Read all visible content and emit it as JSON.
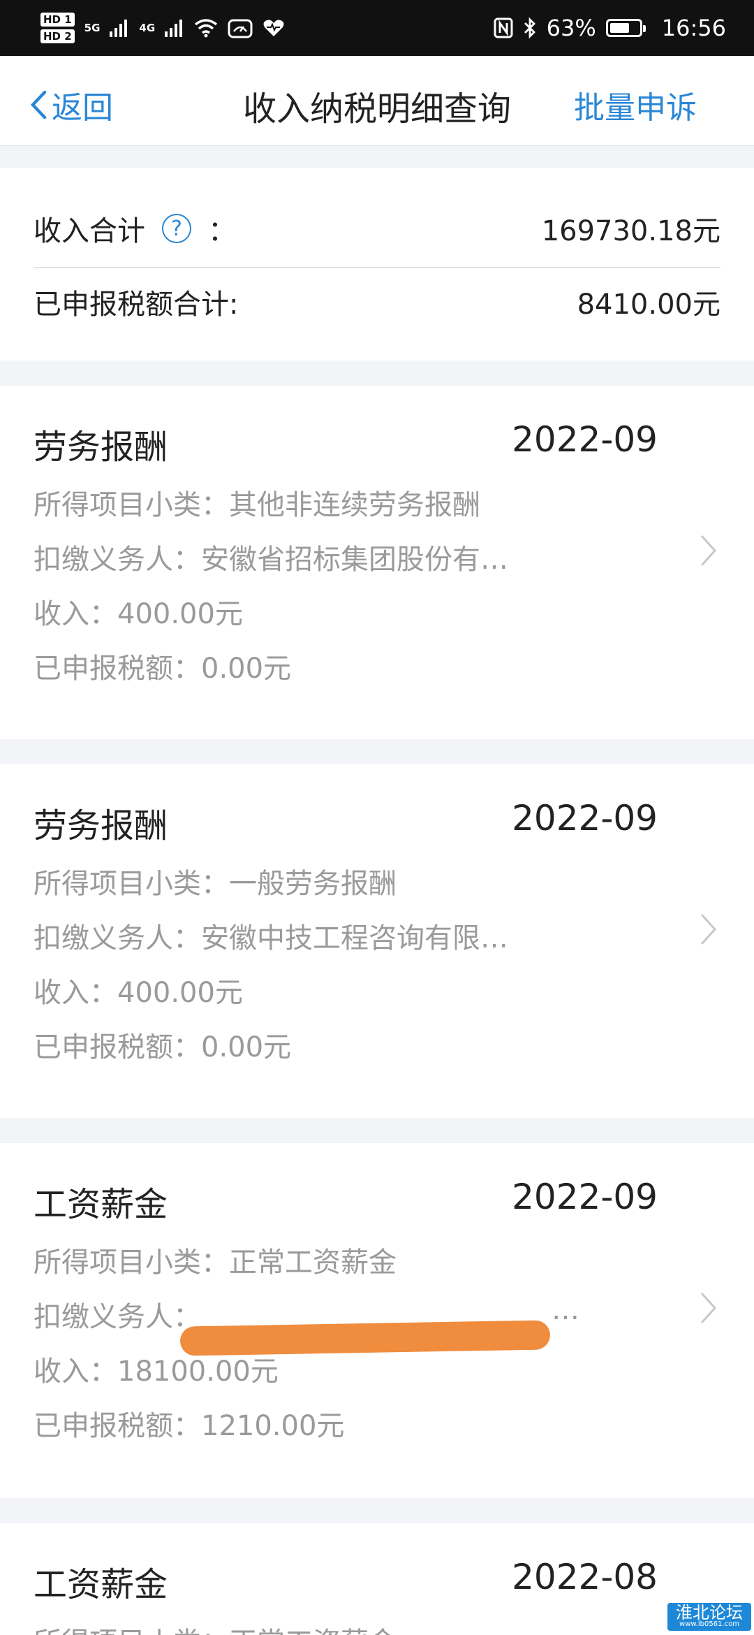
{
  "status_bar": {
    "hd1": "HD 1",
    "hd2": "HD 2",
    "sig1": "5G",
    "sig2": "4G",
    "battery": "63%",
    "time": "16:56"
  },
  "nav": {
    "back_label": "返回",
    "title": "收入纳税明细查询",
    "action_label": "批量申诉"
  },
  "summary": {
    "income_label": "收入合计",
    "colon": "：",
    "income_value": "169730.18元",
    "tax_label": "已申报税额合计:",
    "tax_value": "8410.00元"
  },
  "records": [
    {
      "type": "劳务报酬",
      "month": "2022-09",
      "subcategory": "所得项目小类：其他非连续劳务报酬",
      "withholder": "扣缴义务人：安徽省招标集团股份有…",
      "income": "收入：400.00元",
      "tax": "已申报税额：0.00元"
    },
    {
      "type": "劳务报酬",
      "month": "2022-09",
      "subcategory": "所得项目小类：一般劳务报酬",
      "withholder": "扣缴义务人：安徽中技工程咨询有限…",
      "income": "收入：400.00元",
      "tax": "已申报税额：0.00元"
    },
    {
      "type": "工资薪金",
      "month": "2022-09",
      "subcategory": "所得项目小类：正常工资薪金",
      "withholder": "扣缴义务人：",
      "withholder_tail": "…",
      "income": "收入：18100.00元",
      "tax": "已申报税额：1210.00元"
    },
    {
      "type": "工资薪金",
      "month": "2022-08",
      "subcategory": "所得项目小类：正常工资薪金"
    }
  ],
  "watermark": {
    "text": "淮北论坛",
    "url": "www.lb0561.com"
  },
  "colors": {
    "accent": "#2a87d6",
    "muted_text": "#9a9a9a",
    "redaction": "#f08c3e"
  }
}
